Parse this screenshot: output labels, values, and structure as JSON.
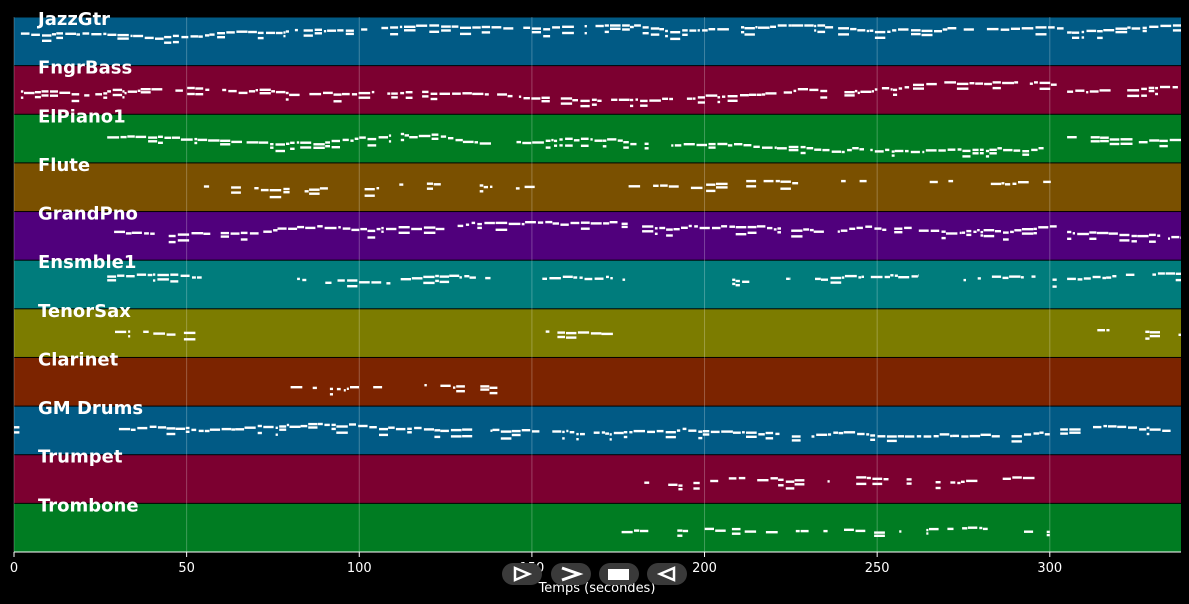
{
  "chart_data": {
    "type": "heatmap",
    "xlabel": "Temps (secondes)",
    "xlim": [
      0,
      338
    ],
    "xticks": [
      0,
      50,
      100,
      150,
      200,
      250,
      300
    ],
    "grid": true,
    "tracks": [
      {
        "name": "JazzGtr",
        "color": "#015a85",
        "segments": [
          [
            2,
            304
          ],
          [
            305,
            338
          ]
        ],
        "pitch_range": [
          0.55,
          0.85
        ],
        "density": 0.9
      },
      {
        "name": "FngrBass",
        "color": "#7c0030",
        "segments": [
          [
            2,
            27
          ],
          [
            27,
            302
          ],
          [
            305,
            338
          ]
        ],
        "pitch_range": [
          0.3,
          0.68
        ],
        "density": 0.8
      },
      {
        "name": "ElPiano1",
        "color": "#007c22",
        "segments": [
          [
            27,
            302
          ],
          [
            305,
            338
          ]
        ],
        "pitch_range": [
          0.25,
          0.8
        ],
        "density": 0.9
      },
      {
        "name": "Flute",
        "color": "#7a5000",
        "segments": [
          [
            55,
            152
          ],
          [
            178,
            308
          ]
        ],
        "pitch_range": [
          0.4,
          0.65
        ],
        "density": 0.4
      },
      {
        "name": "GrandPno",
        "color": "#50007c",
        "segments": [
          [
            29,
            302
          ],
          [
            305,
            338
          ]
        ],
        "pitch_range": [
          0.3,
          0.85
        ],
        "density": 0.9
      },
      {
        "name": "Ensmble1",
        "color": "#007c7c",
        "segments": [
          [
            27,
            55
          ],
          [
            82,
            109
          ],
          [
            112,
            138
          ],
          [
            153,
            177
          ],
          [
            208,
            225
          ],
          [
            232,
            262
          ],
          [
            275,
            302
          ],
          [
            305,
            338
          ]
        ],
        "pitch_range": [
          0.55,
          0.75
        ],
        "density": 0.8
      },
      {
        "name": "TenorSax",
        "color": "#7c7c00",
        "segments": [
          [
            28,
            53
          ],
          [
            154,
            175
          ],
          [
            307,
            338
          ]
        ],
        "pitch_range": [
          0.35,
          0.75
        ],
        "density": 0.4
      },
      {
        "name": "Clarinet",
        "color": "#7c2400",
        "segments": [
          [
            78,
            109
          ],
          [
            116,
            153
          ]
        ],
        "pitch_range": [
          0.35,
          0.6
        ],
        "density": 0.5
      },
      {
        "name": "GM Drums",
        "color": "#015a85",
        "segments": [
          [
            0,
            2
          ],
          [
            27,
            300
          ],
          [
            303,
            335
          ]
        ],
        "pitch_range": [
          0.4,
          0.75
        ],
        "density": 0.9
      },
      {
        "name": "Trumpet",
        "color": "#7c0030",
        "segments": [
          [
            173,
            300
          ]
        ],
        "pitch_range": [
          0.35,
          0.6
        ],
        "density": 0.5
      },
      {
        "name": "Trombone",
        "color": "#007c22",
        "segments": [
          [
            173,
            300
          ]
        ],
        "pitch_range": [
          0.35,
          0.6
        ],
        "density": 0.5
      }
    ]
  },
  "controls": [
    {
      "name": "play-button",
      "icon": "play-icon"
    },
    {
      "name": "fast-forward-button",
      "icon": "fast-forward-icon"
    },
    {
      "name": "stop-button",
      "icon": "stop-icon"
    },
    {
      "name": "rewind-button",
      "icon": "rewind-icon"
    }
  ]
}
